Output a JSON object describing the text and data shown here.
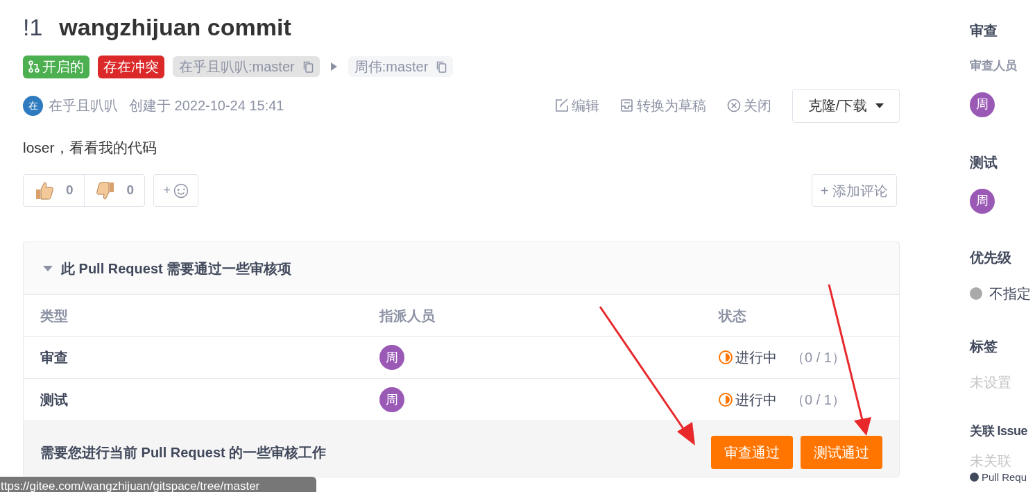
{
  "title": {
    "number": "!1",
    "text": "wangzhijuan commit"
  },
  "tags": [
    {
      "kind": "status",
      "label": "开启的",
      "color": "#4caf50"
    },
    {
      "kind": "status",
      "label": "存在冲突",
      "color": "#db2828"
    },
    {
      "kind": "branch",
      "label": "在乎且叭叭:master",
      "selected": true
    },
    {
      "kind": "branch",
      "label": "周伟:master",
      "selected": false
    }
  ],
  "meta": {
    "avatar": "在",
    "author": "在乎且叭叭",
    "created": "创建于 2022-10-24 15:41"
  },
  "actions": [
    {
      "kind": "edit",
      "label": "编辑"
    },
    {
      "kind": "draft",
      "label": "转换为草稿"
    },
    {
      "kind": "close",
      "label": "关闭"
    }
  ],
  "clone_button": "克隆/下载",
  "description": "loser，看看我的代码",
  "reactions": [
    {
      "kind": "up",
      "count": "0"
    },
    {
      "kind": "down",
      "count": "0"
    }
  ],
  "add_reaction": "+",
  "add_comment": "+ 添加评论",
  "checks": {
    "title": "此 Pull Request 需要通过一些审核项",
    "expanded": true,
    "columns": [
      "类型",
      "指派人员",
      "状态"
    ],
    "rows": [
      {
        "type": "审查",
        "assignee": "周",
        "status": "进行中",
        "progress": "（0 / 1）"
      },
      {
        "type": "测试",
        "assignee": "周",
        "status": "进行中",
        "progress": "（0 / 1）"
      }
    ],
    "footer": "需要您进行当前 Pull Request 的一些审核工作",
    "buttons": [
      "审查通过",
      "测试通过"
    ]
  },
  "sidebar": {
    "review": {
      "title": "审查",
      "subtitle": "审查人员",
      "avatar": "周"
    },
    "test": {
      "title": "测试",
      "avatar": "周"
    },
    "priority": {
      "title": "优先级",
      "value": "不指定",
      "color": "#aaaaaa"
    },
    "labels": {
      "title": "标签",
      "value": "未设置"
    },
    "issues": {
      "title": "关联 Issue",
      "value": "未关联"
    },
    "last": "Pull Requ"
  },
  "status_bar": "ttps://gitee.com/wangzhijuan/gitspace/tree/master"
}
